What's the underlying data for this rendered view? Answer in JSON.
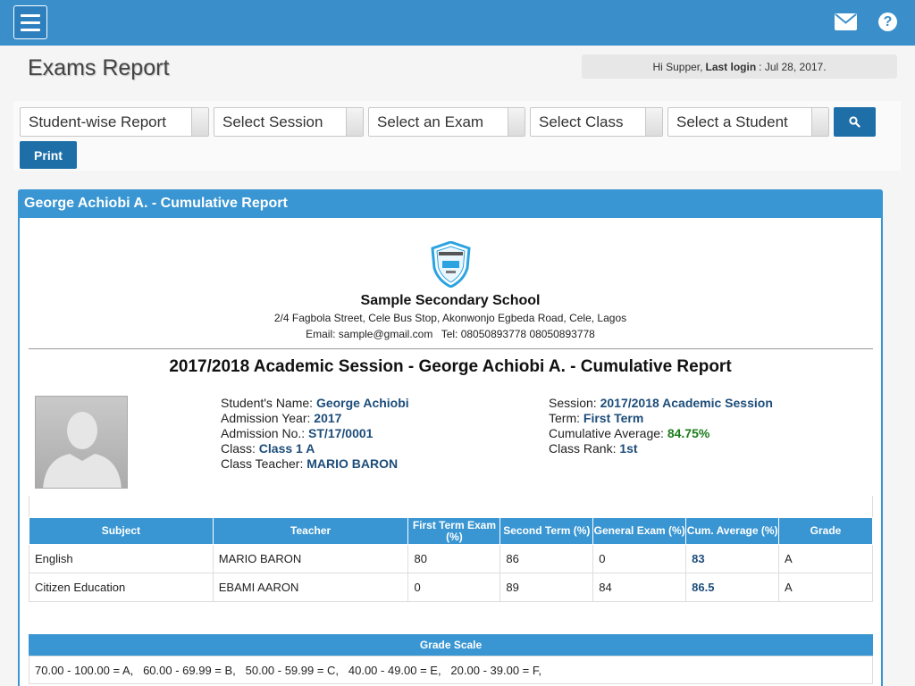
{
  "header": {
    "menu_icon": "hamburger-icon",
    "mail_icon": "envelope-icon",
    "help_icon": "question-circle-icon",
    "help_glyph": "?"
  },
  "page_title": "Exams Report",
  "login": {
    "greeting": "Hi Supper,",
    "label": "Last login",
    "date": ": Jul 28, 2017."
  },
  "filters": {
    "report_type": "Student-wise Report",
    "session": "Select Session",
    "exam": "Select an Exam",
    "class": "Select Class",
    "student": "Select a Student",
    "search_icon": "search-icon",
    "print_label": "Print"
  },
  "report": {
    "panel_title": "George Achiobi A. - Cumulative Report",
    "school_name": "Sample Secondary School",
    "school_address": "2/4 Fagbola Street, Cele Bus Stop, Akonwonjo Egbeda Road, Cele, Lagos",
    "school_email": "Email: sample@gmail.com",
    "school_tel": "Tel: 08050893778 08050893778",
    "title": "2017/2018 Academic Session - George Achiobi A. - Cumulative Report",
    "student": {
      "name_label": "Student's Name:",
      "name": "George Achiobi",
      "admission_year_label": "Admission Year:",
      "admission_year": "2017",
      "admission_no_label": "Admission No.:",
      "admission_no": "ST/17/0001",
      "class_label": "Class:",
      "class": "Class 1 A",
      "teacher_label": "Class Teacher:",
      "teacher": "MARIO BARON",
      "session_label": "Session:",
      "session": "2017/2018 Academic Session",
      "term_label": "Term:",
      "term": "First Term",
      "cum_avg_label": "Cumulative Average:",
      "cum_avg": "84.75%",
      "rank_label": "Class Rank:",
      "rank": "1st"
    },
    "table": {
      "headers": [
        "Subject",
        "Teacher",
        "First Term Exam (%)",
        "Second Term (%)",
        "General Exam (%)",
        "Cum. Average (%)",
        "Grade"
      ],
      "rows": [
        [
          "English",
          "MARIO BARON",
          "80",
          "86",
          "0",
          "83",
          "A"
        ],
        [
          "Citizen Education",
          "EBAMI AARON",
          "0",
          "89",
          "84",
          "86.5",
          "A"
        ]
      ]
    },
    "grade_scale": {
      "title": "Grade Scale",
      "text": "70.00 - 100.00 = A,   60.00 - 69.99 = B,   50.00 - 59.99 = C,   40.00 - 49.00 = E,   20.00 - 39.00 = F,"
    }
  },
  "colors": {
    "topbar": "#3a8fcb",
    "panel": "#3a96d2",
    "button": "#1e6fa8",
    "value_text": "#1d4d7a",
    "average_green": "#1b7a1b"
  }
}
